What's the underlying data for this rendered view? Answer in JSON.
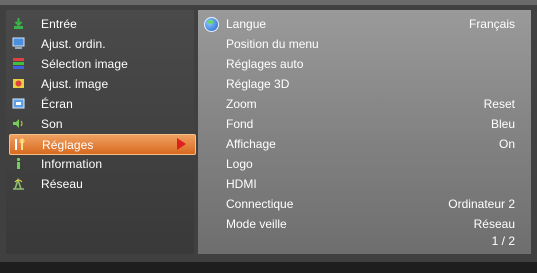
{
  "sidebar": {
    "items": [
      {
        "label": "Entrée",
        "icon": "input-icon",
        "color": "#3bb34a"
      },
      {
        "label": "Ajust. ordin.",
        "icon": "computer-icon",
        "color": "#4a8fe0"
      },
      {
        "label": "Sélection image",
        "icon": "image-select-icon",
        "color": "#e04040"
      },
      {
        "label": "Ajust. image",
        "icon": "image-adjust-icon",
        "color": "#e8d040"
      },
      {
        "label": "Écran",
        "icon": "screen-icon",
        "color": "#5aa0e6"
      },
      {
        "label": "Son",
        "icon": "speaker-icon",
        "color": "#7acb5a"
      },
      {
        "label": "Réglages",
        "icon": "tools-icon",
        "color": "#e06a20"
      },
      {
        "label": "Information",
        "icon": "info-icon",
        "color": "#6fd35a"
      },
      {
        "label": "Réseau",
        "icon": "network-icon",
        "color": "#6a9a6a"
      }
    ],
    "selected_index": 6
  },
  "main": {
    "rows": [
      {
        "label": "Langue",
        "value": "Français"
      },
      {
        "label": "Position du menu",
        "value": ""
      },
      {
        "label": "Réglages auto",
        "value": ""
      },
      {
        "label": "Réglage 3D",
        "value": ""
      },
      {
        "label": "Zoom",
        "value": "Reset"
      },
      {
        "label": "Fond",
        "value": "Bleu"
      },
      {
        "label": "Affichage",
        "value": "On"
      },
      {
        "label": "Logo",
        "value": ""
      },
      {
        "label": "HDMI",
        "value": ""
      },
      {
        "label": "Connectique",
        "value": "Ordinateur 2"
      },
      {
        "label": "Mode veille",
        "value": "Réseau"
      }
    ],
    "page": "1 / 2"
  },
  "colors": {
    "accent": "#d86a20",
    "arrow": "#e02020"
  }
}
